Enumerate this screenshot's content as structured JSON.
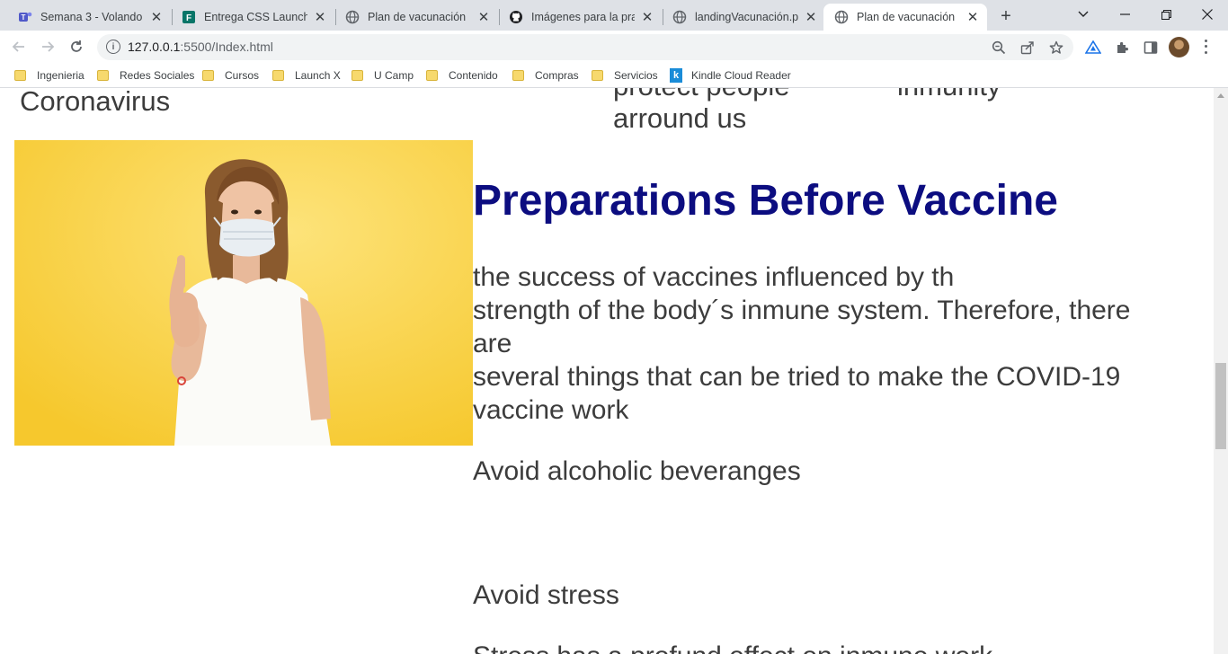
{
  "tabs": [
    {
      "title": "Semana 3 - Volando c",
      "favicon": "teams-icon"
    },
    {
      "title": "Entrega CSS LaunchX",
      "favicon": "forms-icon"
    },
    {
      "title": "Plan de vacunación",
      "favicon": "globe-icon"
    },
    {
      "title": "Imágenes para la prac",
      "favicon": "github-icon"
    },
    {
      "title": "landingVacunación.pn",
      "favicon": "globe-icon"
    },
    {
      "title": "Plan de vacunación",
      "favicon": "globe-icon",
      "active": true
    }
  ],
  "address_bar": {
    "host": "127.0.0.1",
    "path": ":5500/Index.html"
  },
  "bookmarks": [
    "Ingenieria",
    "Redes Sociales",
    "Cursos",
    "Launch X",
    "U Camp",
    "Contenido",
    "Compras",
    "Servicios",
    "Kindle Cloud Reader"
  ],
  "page": {
    "clipped_left": "Coronavirus",
    "clipped_mid_top": "protect people",
    "clipped_mid_bottom": "arround us",
    "clipped_right": "inmunity",
    "heading": "Preparations Before Vaccine",
    "intro_lines": [
      "the success of vaccines influenced by th",
      "strength of the body´s inmune system. Therefore, there",
      "are",
      "several things that can be tried to make the COVID-19",
      "vaccine work"
    ],
    "tip1": "Avoid alcoholic beveranges",
    "tip2": "Avoid stress",
    "tip3": "Stress has a profund effect on inmune work"
  },
  "colors": {
    "heading": "#0c0d80",
    "body_text": "#3c3c3c",
    "image_bg": "#f9d648"
  }
}
